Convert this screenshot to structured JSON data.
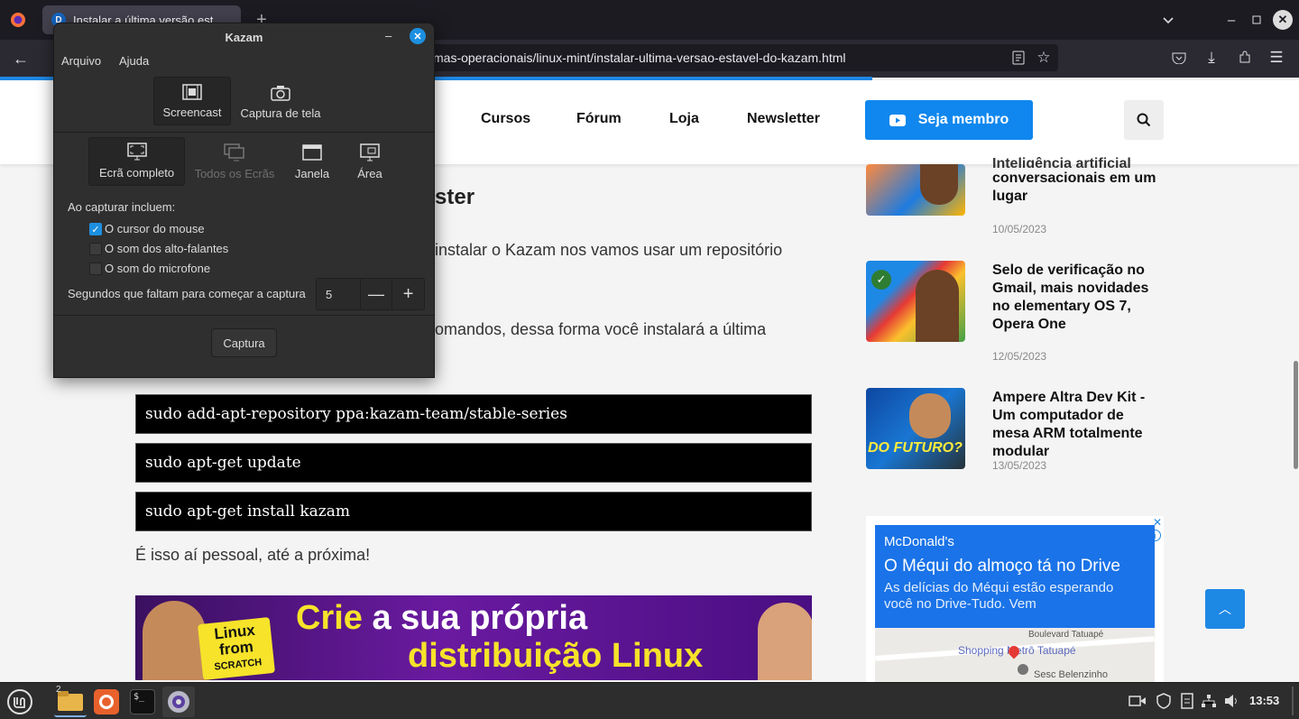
{
  "browser": {
    "tab_title": "Instalar a última versão est",
    "url": "mas-operacionais/linux-mint/instalar-ultima-versao-estavel-do-kazam.html"
  },
  "site": {
    "nav": [
      "Cursos",
      "Fórum",
      "Loja",
      "Newsletter"
    ],
    "member_label": "Seja membro"
  },
  "article": {
    "heading_fragment": "ster",
    "para1_fragment": "instalar o Kazam nos vamos usar um repositório",
    "para2_fragment": "omandos, dessa forma você instalará a última",
    "commands": [
      "sudo add-apt-repository ppa:kazam-team/stable-series",
      "sudo apt-get update",
      "sudo apt-get install kazam"
    ],
    "closing": "É isso aí pessoal, até a próxima!",
    "banner": {
      "badge_line1": "Linux",
      "badge_line2": "from",
      "badge_line3": "SCRATCH",
      "headline_a": "Crie",
      "headline_b": "a sua própria",
      "headline_c": "distribuição Linux"
    }
  },
  "sidebar": {
    "posts": [
      {
        "title_tail": "conversacionais em um lugar",
        "title_cut": "Inteligência artificial",
        "date": "10/05/2023"
      },
      {
        "title": "Selo de verificação no Gmail, mais novidades no elementary OS 7, Opera One",
        "date": "12/05/2023"
      },
      {
        "title": "Ampere Altra Dev Kit - Um computador de mesa ARM totalmente modular",
        "date": "13/05/2023",
        "thumb_text": "DO FUTURO?"
      }
    ],
    "ad": {
      "brand": "McDonald's",
      "headline": "O Méqui do almoço tá no Drive",
      "body": "As delícias do Méqui estão esperando você no Drive-Tudo. Vem",
      "map_labels": [
        "Shopping Metrô Tatuapé",
        "Sesc Belenzinho",
        "Boulevard Tatuapé"
      ]
    }
  },
  "kazam": {
    "title": "Kazam",
    "menu": [
      "Arquivo",
      "Ajuda"
    ],
    "modes": [
      "Screencast",
      "Captura de tela"
    ],
    "sources": [
      "Ecrã completo",
      "Todos os Ecrãs",
      "Janela",
      "Área"
    ],
    "include_label": "Ao capturar incluem:",
    "options": [
      {
        "label": "O cursor do mouse",
        "checked": true
      },
      {
        "label": "O som dos alto-falantes",
        "checked": false
      },
      {
        "label": "O som do microfone",
        "checked": false
      }
    ],
    "delay_label": "Segundos que faltam para começar a captura",
    "delay_value": "5",
    "capture_label": "Captura"
  },
  "taskbar": {
    "badge": "2",
    "clock": "13:53"
  },
  "colors": {
    "accent": "#1e88e5",
    "member": "#0f87ee",
    "check": "#1d8fe0"
  }
}
